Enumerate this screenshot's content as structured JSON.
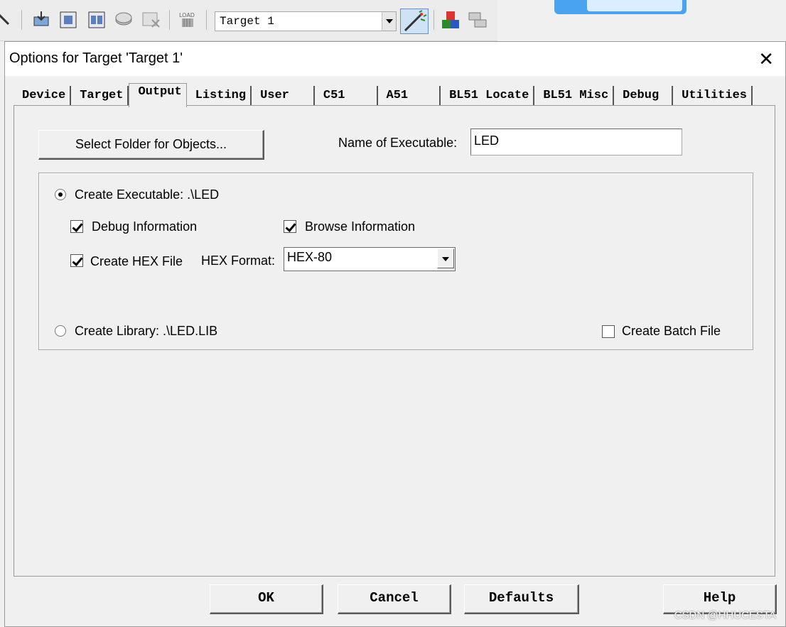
{
  "toolbar": {
    "target_value": "Target 1",
    "icons": [
      "download-icon",
      "build-icon",
      "rebuild-icon",
      "batch-build-icon",
      "stop-build-icon",
      "load-icon",
      "target-options-icon",
      "manage-components-icon",
      "select-packs-icon"
    ]
  },
  "dialog": {
    "title": "Options for Target 'Target 1'",
    "close": "✕",
    "tabs": [
      "Device",
      "Target",
      "Output",
      "Listing",
      "User",
      "C51",
      "A51",
      "BL51 Locate",
      "BL51 Misc",
      "Debug",
      "Utilities"
    ],
    "active_tab": "Output",
    "select_folder_label": "Select Folder for Objects...",
    "name_of_executable_label": "Name of Executable:",
    "name_of_executable_value": "LED",
    "create_executable_label": "Create Executable:  .\\LED",
    "create_executable_selected": true,
    "debug_info_label": "Debug Information",
    "debug_info_checked": true,
    "browse_info_label": "Browse Information",
    "browse_info_checked": true,
    "create_hex_label": "Create HEX File",
    "create_hex_checked": true,
    "hex_format_label": "HEX Format:",
    "hex_format_value": "HEX-80",
    "create_library_label": "Create Library:  .\\LED.LIB",
    "create_library_selected": false,
    "create_batch_label": "Create Batch File",
    "create_batch_checked": false,
    "buttons": {
      "ok": "OK",
      "cancel": "Cancel",
      "defaults": "Defaults",
      "help": "Help"
    }
  },
  "watermark": "CSDN @HHUCESTA",
  "colors": {
    "dialog_bg": "#f0f0f0",
    "titlebar_bg": "#ffffff",
    "toolbar_active": "#cfe3f7",
    "banner_blue": "#4aa3f0"
  }
}
